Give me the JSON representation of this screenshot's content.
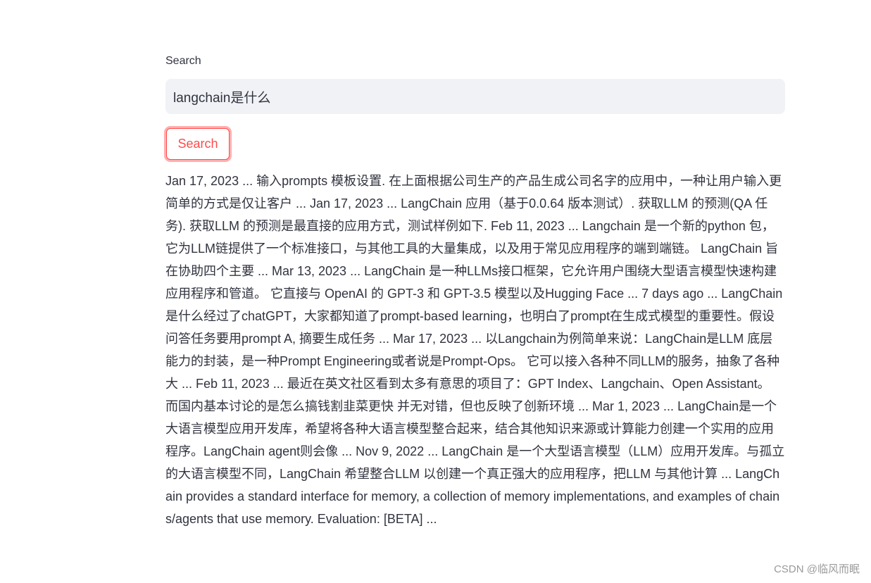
{
  "search": {
    "label": "Search",
    "value": "langchain是什么",
    "button_label": "Search"
  },
  "result": {
    "text": "Jan 17, 2023 ... 输入prompts 模板设置. 在上面根据公司生产的产品生成公司名字的应用中，一种让用户输入更简单的方式是仅让客户 ... Jan 17, 2023 ... LangChain 应用（基于0.0.64 版本测试）. 获取LLM 的预测(QA 任务). 获取LLM 的预测是最直接的应用方式，测试样例如下. Feb 11, 2023 ... Langchain 是一个新的python 包，它为LLM链提供了一个标准接口，与其他工具的大量集成，以及用于常见应用程序的端到端链。 LangChain 旨在协助四个主要 ... Mar 13, 2023 ... LangChain 是一种LLMs接口框架，它允许用户围绕大型语言模型快速构建应用程序和管道。 它直接与 OpenAI 的 GPT-3 和 GPT-3.5 模型以及Hugging Face ... 7 days ago ... LangChain是什么经过了chatGPT，大家都知道了prompt-based learning，也明白了prompt在生成式模型的重要性。假设问答任务要用prompt A, 摘要生成任务 ... Mar 17, 2023 ... 以Langchain为例简单来说：LangChain是LLM 底层能力的封装，是一种Prompt Engineering或者说是Prompt-Ops。 它可以接入各种不同LLM的服务，抽象了各种大 ... Feb 11, 2023 ... 最近在英文社区看到太多有意思的项目了：GPT Index、Langchain、Open Assistant。 而国内基本讨论的是怎么搞钱割韭菜更快 并无对错，但也反映了创新环境 ... Mar 1, 2023 ... LangChain是一个大语言模型应用开发库，希望将各种大语言模型整合起来，结合其他知识来源或计算能力创建一个实用的应用程序。LangChain agent则会像 ... Nov 9, 2022 ... LangChain 是一个大型语言模型（LLM）应用开发库。与孤立的大语言模型不同，LangChain 希望整合LLM 以创建一个真正强大的应用程序，把LLM 与其他计算 ... LangChain provides a standard interface for memory, a collection of memory implementations, and examples of chains/agents that use memory. Evaluation: [BETA] ..."
  },
  "watermark": "CSDN @临风而眠"
}
